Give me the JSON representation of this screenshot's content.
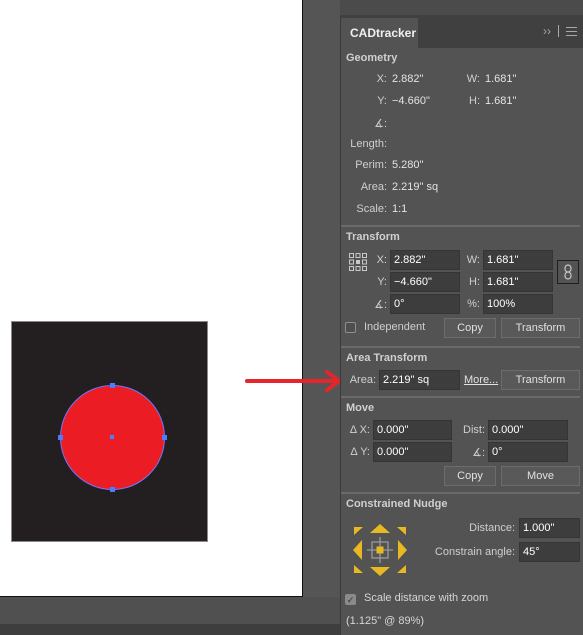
{
  "panel": {
    "tab_title": "CADtracker",
    "collapse_icon": "double-chevron-right-icon",
    "menu_icon": "hamburger-menu-icon"
  },
  "geometry": {
    "title": "Geometry",
    "x_label": "X:",
    "x_value": "2.882\"",
    "w_label": "W:",
    "w_value": "1.681\"",
    "y_label": "Y:",
    "y_value": "−4.660\"",
    "h_label": "H:",
    "h_value": "1.681\"",
    "angle_label": "∡:",
    "angle_value": "",
    "length_label": "Length:",
    "length_value": "",
    "perim_label": "Perim:",
    "perim_value": "5.280\"",
    "area_label": "Area:",
    "area_value": "2.219\" sq",
    "scale_label": "Scale:",
    "scale_value": "1:1"
  },
  "transform": {
    "title": "Transform",
    "x_label": "X:",
    "x_value": "2.882\"",
    "w_label": "W:",
    "w_value": "1.681\"",
    "y_label": "Y:",
    "y_value": "−4.660\"",
    "h_label": "H:",
    "h_value": "1.681\"",
    "angle_label": "∡:",
    "angle_value": "0°",
    "percent_label": "%:",
    "percent_value": "100%",
    "independent_label": "Independent",
    "independent_checked": false,
    "copy_label": "Copy",
    "transform_label": "Transform"
  },
  "area_transform": {
    "title": "Area Transform",
    "area_label": "Area:",
    "area_value": "2.219\" sq",
    "more_label": "More...",
    "transform_label": "Transform"
  },
  "move": {
    "title": "Move",
    "dx_label": "Δ X:",
    "dx_value": "0.000\"",
    "dist_label": "Dist:",
    "dist_value": "0.000\"",
    "dy_label": "Δ Y:",
    "dy_value": "0.000\"",
    "angle_label": "∡:",
    "angle_value": "0°",
    "copy_label": "Copy",
    "move_label": "Move"
  },
  "nudge": {
    "title": "Constrained Nudge",
    "distance_label": "Distance:",
    "distance_value": "1.000\"",
    "angle_label": "Constrain angle:",
    "angle_value": "45°",
    "scale_label": "Scale distance with zoom",
    "scale_checked": true,
    "status": "(1.125\" @ 89%)",
    "accent_color": "#e8b923"
  },
  "canvas": {
    "rect_color": "#231f20",
    "circle_color": "#ec1c24",
    "selection_color": "#4a7dff",
    "arrow_color": "#e3262b"
  }
}
